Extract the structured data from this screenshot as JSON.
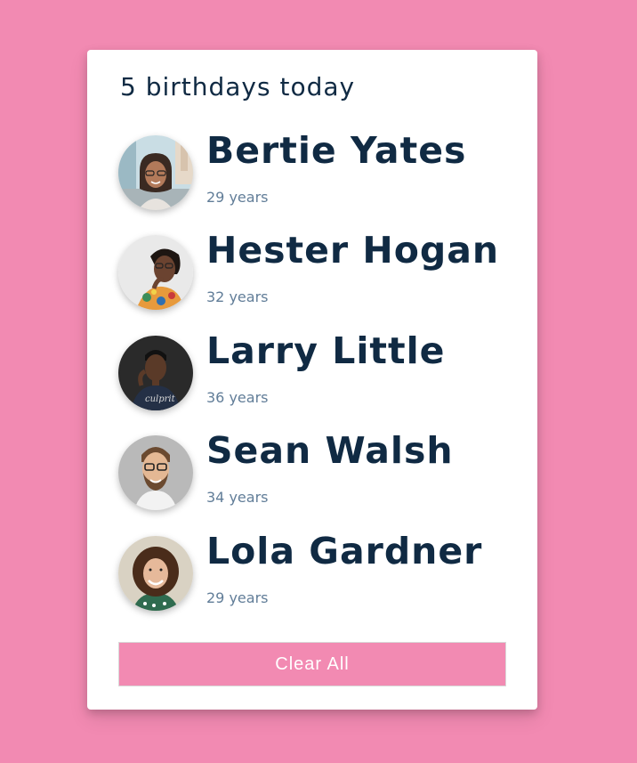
{
  "title": "5 birthdays today",
  "people": [
    {
      "name": "Bertie Yates",
      "age": "29 years",
      "avatar": "woman-glasses-street-avatar"
    },
    {
      "name": "Hester Hogan",
      "age": "32 years",
      "avatar": "woman-glasses-floral-avatar"
    },
    {
      "name": "Larry Little",
      "age": "36 years",
      "avatar": "man-dark-shirt-avatar"
    },
    {
      "name": "Sean Walsh",
      "age": "34 years",
      "avatar": "man-glasses-beard-avatar"
    },
    {
      "name": "Lola Gardner",
      "age": "29 years",
      "avatar": "woman-curly-hair-avatar"
    }
  ],
  "button": {
    "label": "Clear All"
  },
  "colors": {
    "background": "#f28ab2",
    "card": "#ffffff",
    "name_text": "#102a43",
    "age_text": "#617d98",
    "button": "#f28ab2"
  }
}
